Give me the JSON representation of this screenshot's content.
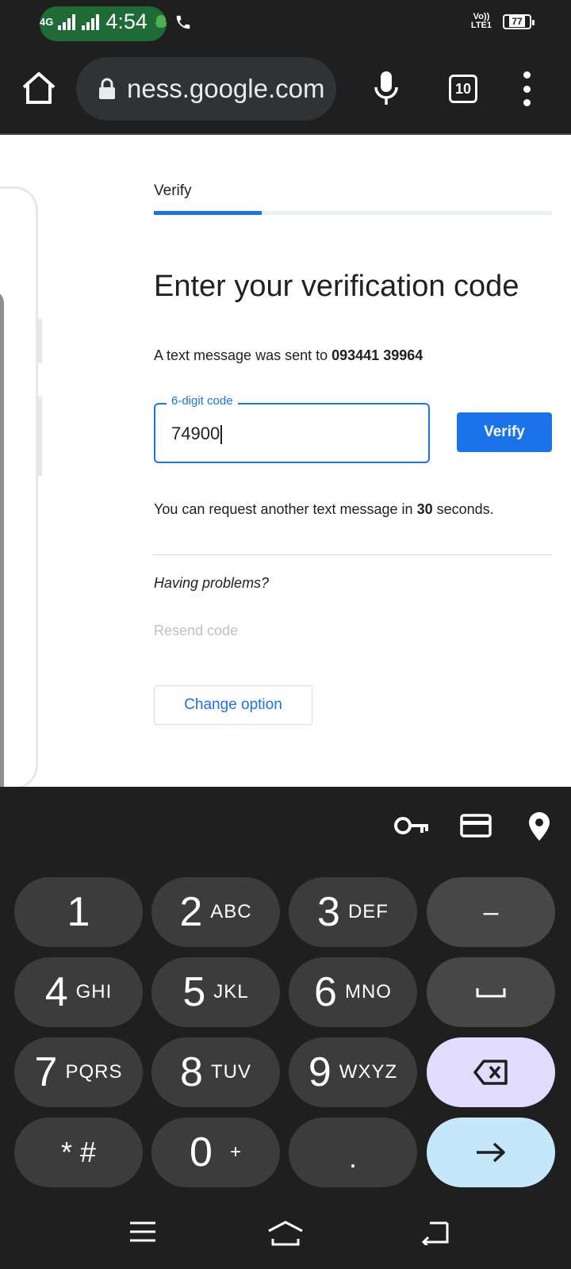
{
  "status_bar": {
    "network": "4G",
    "time": "4:54",
    "volte_line1": "Vo))",
    "volte_line2": "LTE1",
    "battery": "77"
  },
  "browser": {
    "url": "ness.google.com",
    "tab_count": "10"
  },
  "page": {
    "step_label": "Verify",
    "progress_fraction": 0.27,
    "heading": "Enter your verification code",
    "sent_prefix": "A text message was sent to ",
    "phone_number": "093441 39964",
    "code_label": "6-digit code",
    "code_value": "74900",
    "verify_button": "Verify",
    "wait_prefix": "You can request another text message in ",
    "wait_seconds": "30",
    "wait_suffix": " seconds.",
    "problems": "Having problems?",
    "resend": "Resend code",
    "change_option": "Change option"
  },
  "keyboard": {
    "keys": [
      {
        "num": "1",
        "sub": ""
      },
      {
        "num": "2",
        "sub": "ABC"
      },
      {
        "num": "3",
        "sub": "DEF"
      },
      {
        "num": "4",
        "sub": "GHI"
      },
      {
        "num": "5",
        "sub": "JKL"
      },
      {
        "num": "6",
        "sub": "MNO"
      },
      {
        "num": "7",
        "sub": "PQRS"
      },
      {
        "num": "8",
        "sub": "TUV"
      },
      {
        "num": "9",
        "sub": "WXYZ"
      },
      {
        "num": "0",
        "sub": "+"
      }
    ],
    "star_hash": "* #",
    "dot": ".",
    "dash": "–"
  }
}
